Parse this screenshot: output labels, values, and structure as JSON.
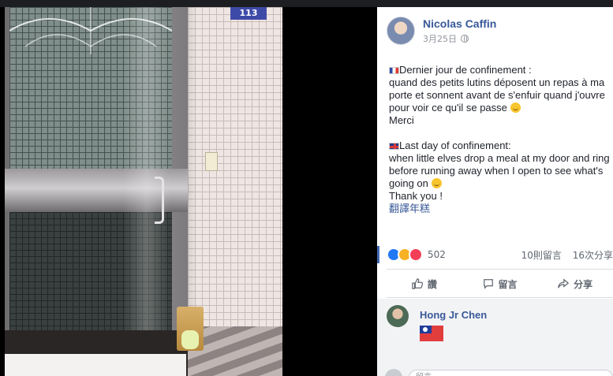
{
  "top_bar": {
    "items": [
      "",
      "",
      "",
      ""
    ]
  },
  "photo": {
    "door_number": "113"
  },
  "post": {
    "author": "Nicolas Caffin",
    "date": "3月25日",
    "text_fr": [
      "Dernier jour de confinement :",
      "quand des petits lutins déposent un repas à ma",
      "porte et sonnent avant de s'enfuir quand j'ouvre",
      "pour voir ce qu'il se passe"
    ],
    "merci": "Merci",
    "text_en": [
      "Last day of confinement:",
      "when little elves drop a meal at my door and ring",
      "before running away when I open to see what's",
      "going on"
    ],
    "thank_you": "Thank you !",
    "translate_link": "翻譯年糕"
  },
  "reactions": {
    "count": "502",
    "comments": "10則留言",
    "shares": "16次分享"
  },
  "actions": {
    "like": "讚",
    "comment": "留言",
    "share": "分享"
  },
  "comments": [
    {
      "author": "Hong Jr Chen"
    }
  ],
  "comment_input": {
    "placeholder": "留言……"
  },
  "colors": {
    "link": "#385898",
    "accent": "#4267b2",
    "text": "#1d2129",
    "muted": "#606770"
  }
}
